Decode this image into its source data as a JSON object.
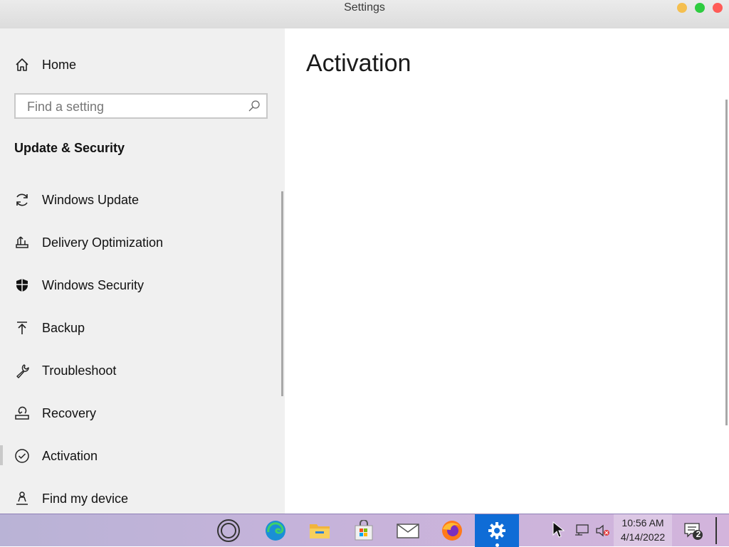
{
  "window": {
    "title": "Settings"
  },
  "sidebar": {
    "home_label": "Home",
    "search": {
      "placeholder": "Find a setting",
      "value": ""
    },
    "section_title": "Update & Security",
    "items": [
      {
        "label": "Windows Update",
        "icon": "refresh-icon"
      },
      {
        "label": "Delivery Optimization",
        "icon": "delivery-optimization-icon"
      },
      {
        "label": "Windows Security",
        "icon": "shield-icon"
      },
      {
        "label": "Backup",
        "icon": "upload-arrow-icon"
      },
      {
        "label": "Troubleshoot",
        "icon": "wrench-icon"
      },
      {
        "label": "Recovery",
        "icon": "recovery-icon"
      },
      {
        "label": "Activation",
        "icon": "check-circle-icon",
        "selected": true
      },
      {
        "label": "Find my device",
        "icon": "person-location-icon"
      }
    ]
  },
  "main": {
    "title": "Activation"
  },
  "taskbar": {
    "apps": [
      "cortana-icon",
      "edge-icon",
      "file-explorer-icon",
      "store-icon",
      "mail-icon",
      "firefox-icon",
      "settings-icon"
    ],
    "active_app": "settings-icon",
    "clock": {
      "time": "10:56 AM",
      "date": "4/14/2022"
    },
    "notification_count": "2",
    "colors": {
      "active": "#0f6cd6"
    }
  }
}
